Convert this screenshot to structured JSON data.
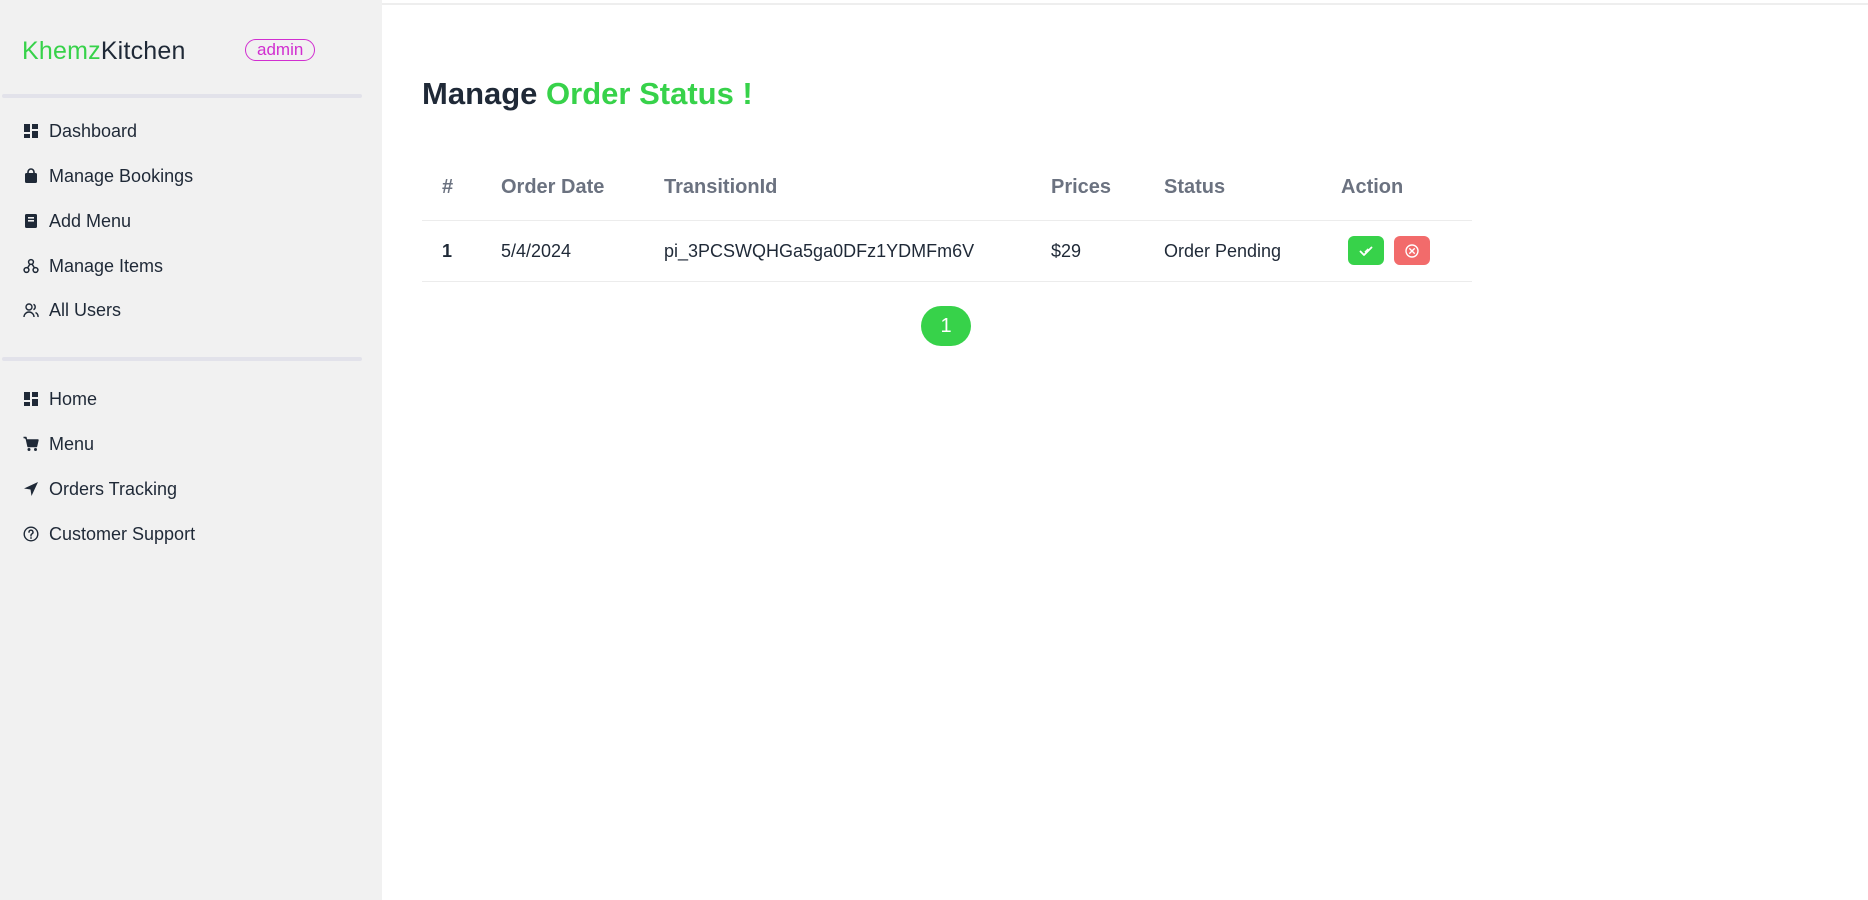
{
  "sidebar": {
    "brand_accent": "Khemz",
    "brand_rest": "Kitchen",
    "role_badge": "admin",
    "admin_items": [
      {
        "label": "Dashboard",
        "icon": "dashboard-icon"
      },
      {
        "label": "Manage Bookings",
        "icon": "shopping-bag-icon"
      },
      {
        "label": "Add Menu",
        "icon": "book-icon"
      },
      {
        "label": "Manage Items",
        "icon": "network-icon"
      },
      {
        "label": "All Users",
        "icon": "users-icon"
      }
    ],
    "site_items": [
      {
        "label": "Home",
        "icon": "dashboard-icon"
      },
      {
        "label": "Menu",
        "icon": "cart-icon"
      },
      {
        "label": "Orders Tracking",
        "icon": "location-arrow-icon"
      },
      {
        "label": "Customer Support",
        "icon": "question-circle-icon"
      }
    ]
  },
  "main": {
    "title_prefix": "Manage",
    "title_accent": "Order Status !",
    "table": {
      "headers": [
        "#",
        "Order Date",
        "TransitionId",
        "Prices",
        "Status",
        "Action"
      ],
      "rows": [
        {
          "index": "1",
          "date": "5/4/2024",
          "transaction_id": "pi_3PCSWQHGa5ga0DFz1YDMFm6V",
          "price": "$29",
          "status": "Order Pending"
        }
      ]
    },
    "pagination": {
      "current": "1"
    }
  },
  "colors": {
    "accent": "#37d24a",
    "badge": "#d12ed0",
    "reject": "#f26b6b",
    "sidebar_bg": "#f1f1f1"
  }
}
